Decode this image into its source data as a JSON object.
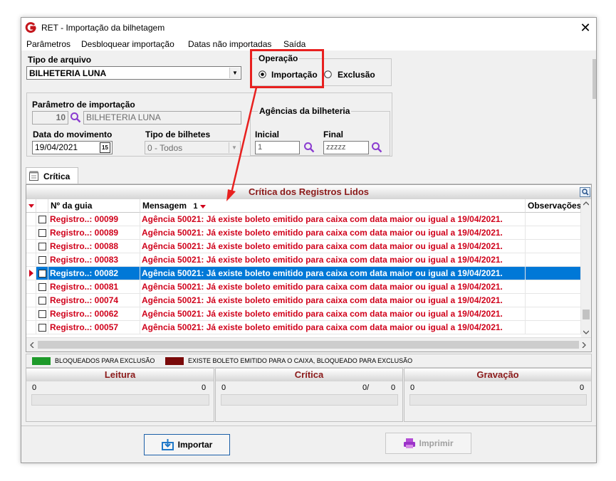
{
  "window": {
    "title": "RET - Importação da bilhetagem",
    "close_glyph": "✕"
  },
  "menu": [
    "Parâmetros",
    "Desbloquear importação",
    "Datas não importadas",
    "Saída"
  ],
  "tipo_arquivo": {
    "label": "Tipo de arquivo",
    "value": "BILHETERIA LUNA"
  },
  "operacao": {
    "label": "Operação",
    "importacao": "Importação",
    "exclusao": "Exclusão",
    "selected": "Importação"
  },
  "parametro": {
    "label": "Parâmetro de importação",
    "code": "10",
    "name": "BILHETERIA LUNA"
  },
  "data_movimento": {
    "label": "Data do movimento",
    "value": "19/04/2021",
    "cal_label": "15"
  },
  "tipo_bilhetes": {
    "label": "Tipo de bilhetes",
    "value": "0 - Todos"
  },
  "agencias": {
    "label": "Agências da bilheteria",
    "inicial_label": "Inicial",
    "inicial_value": "1",
    "final_label": "Final",
    "final_value": "zzzzz"
  },
  "tab": {
    "label": "Crítica"
  },
  "grid": {
    "title": "Crítica dos Registros Lidos",
    "columns": {
      "guia": "Nº da guia",
      "mensagem": "Mensagem",
      "sort_index": "1",
      "obs": "Observações"
    },
    "rows": [
      {
        "guia": "Registro..: 00099",
        "mensagem": "Agência 50021: Já existe boleto emitido para caixa com data maior ou igual a 19/04/2021.",
        "selected": false
      },
      {
        "guia": "Registro..: 00089",
        "mensagem": "Agência 50021: Já existe boleto emitido para caixa com data maior ou igual a 19/04/2021.",
        "selected": false
      },
      {
        "guia": "Registro..: 00088",
        "mensagem": "Agência 50021: Já existe boleto emitido para caixa com data maior ou igual a 19/04/2021.",
        "selected": false
      },
      {
        "guia": "Registro..: 00083",
        "mensagem": "Agência 50021: Já existe boleto emitido para caixa com data maior ou igual a 19/04/2021.",
        "selected": false
      },
      {
        "guia": "Registro..: 00082",
        "mensagem": "Agência 50021: Já existe boleto emitido para caixa com data maior ou igual a 19/04/2021.",
        "selected": true
      },
      {
        "guia": "Registro..: 00081",
        "mensagem": "Agência 50021: Já existe boleto emitido para caixa com data maior ou igual a 19/04/2021.",
        "selected": false
      },
      {
        "guia": "Registro..: 00074",
        "mensagem": "Agência 50021: Já existe boleto emitido para caixa com data maior ou igual a 19/04/2021.",
        "selected": false
      },
      {
        "guia": "Registro..: 00062",
        "mensagem": "Agência 50021: Já existe boleto emitido para caixa com data maior ou igual a 19/04/2021.",
        "selected": false
      },
      {
        "guia": "Registro..: 00057",
        "mensagem": "Agência 50021: Já existe boleto emitido para caixa com data maior ou igual a 19/04/2021.",
        "selected": false
      }
    ]
  },
  "legend": {
    "green": {
      "color": "#1e9a2a",
      "label": "BLOQUEADOS PARA EXCLUSÃO"
    },
    "red": {
      "color": "#7a0a0a",
      "label": "EXISTE BOLETO EMITIDO PARA O CAIXA, BLOQUEADO PARA EXCLUSÃO"
    }
  },
  "panels": {
    "leitura": {
      "title": "Leitura",
      "left": "0",
      "right": "0"
    },
    "critica": {
      "title": "Crítica",
      "left": "0",
      "mid": "0/",
      "right": "0"
    },
    "gravacao": {
      "title": "Gravação",
      "left": "0",
      "right": "0"
    }
  },
  "buttons": {
    "importar": "Importar",
    "imprimir": "Imprimir"
  },
  "colors": {
    "error_text": "#d0021b",
    "title_red": "#8b1a1a",
    "selection": "#0078d7",
    "annotation": "#e8201f"
  }
}
